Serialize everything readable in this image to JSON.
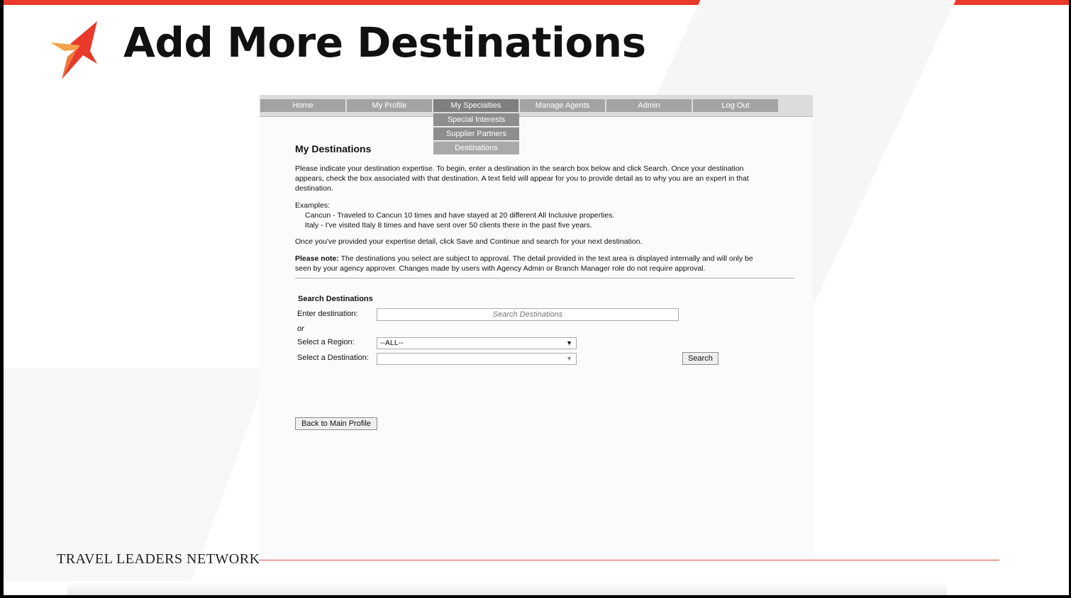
{
  "slide": {
    "title": "Add More Destinations",
    "brand": "TRAVEL LEADERS NETWORK"
  },
  "colors": {
    "accent": "#e8392b",
    "nav_item": "#a3a3a3",
    "nav_active": "#7f7f7f"
  },
  "nav": {
    "items": [
      "Home",
      "My Profile",
      "My Specialties",
      "Manage Agents",
      "Admin",
      "Log Out"
    ],
    "active_index": 2,
    "submenu": [
      "Special Interests",
      "Supplier Partners",
      "Destinations"
    ],
    "submenu_selected_index": 2
  },
  "page": {
    "heading": "My Destinations",
    "intro_1": "Please indicate your destination expertise. To begin, enter a destination in the search box below and click Search. Once your destination",
    "intro_2": "appears, check the box associated with that destination. A text field will appear for you to provide detail as to why you are an expert in that",
    "intro_3": "destination.",
    "examples_label": "Examples:",
    "example_1": "Cancun - Traveled to Cancun 10 times and have stayed at 20 different All Inclusive properties.",
    "example_2": "Italy - I've visited Italy 8 times and have sent over 50 clients there in the past five years.",
    "save_note": "Once you've provided your expertise detail, click Save and Continue and search for your next destination.",
    "note_bold": "Please note:",
    "note_1": " The destinations you select are subject to approval. The detail provided in the text area is displayed internally and will only be",
    "note_2": "seen by your agency approver. Changes made by users with Agency Admin or Branch Manager role do not require approval."
  },
  "search": {
    "heading": "Search Destinations",
    "enter_label": "Enter destination:",
    "placeholder": "Search Destinations",
    "or_label": "or",
    "region_label": "Select a Region:",
    "region_value": "--ALL--",
    "destination_label": "Select a Destination:",
    "destination_value": "",
    "search_button": "Search"
  },
  "back_button": "Back to Main Profile"
}
